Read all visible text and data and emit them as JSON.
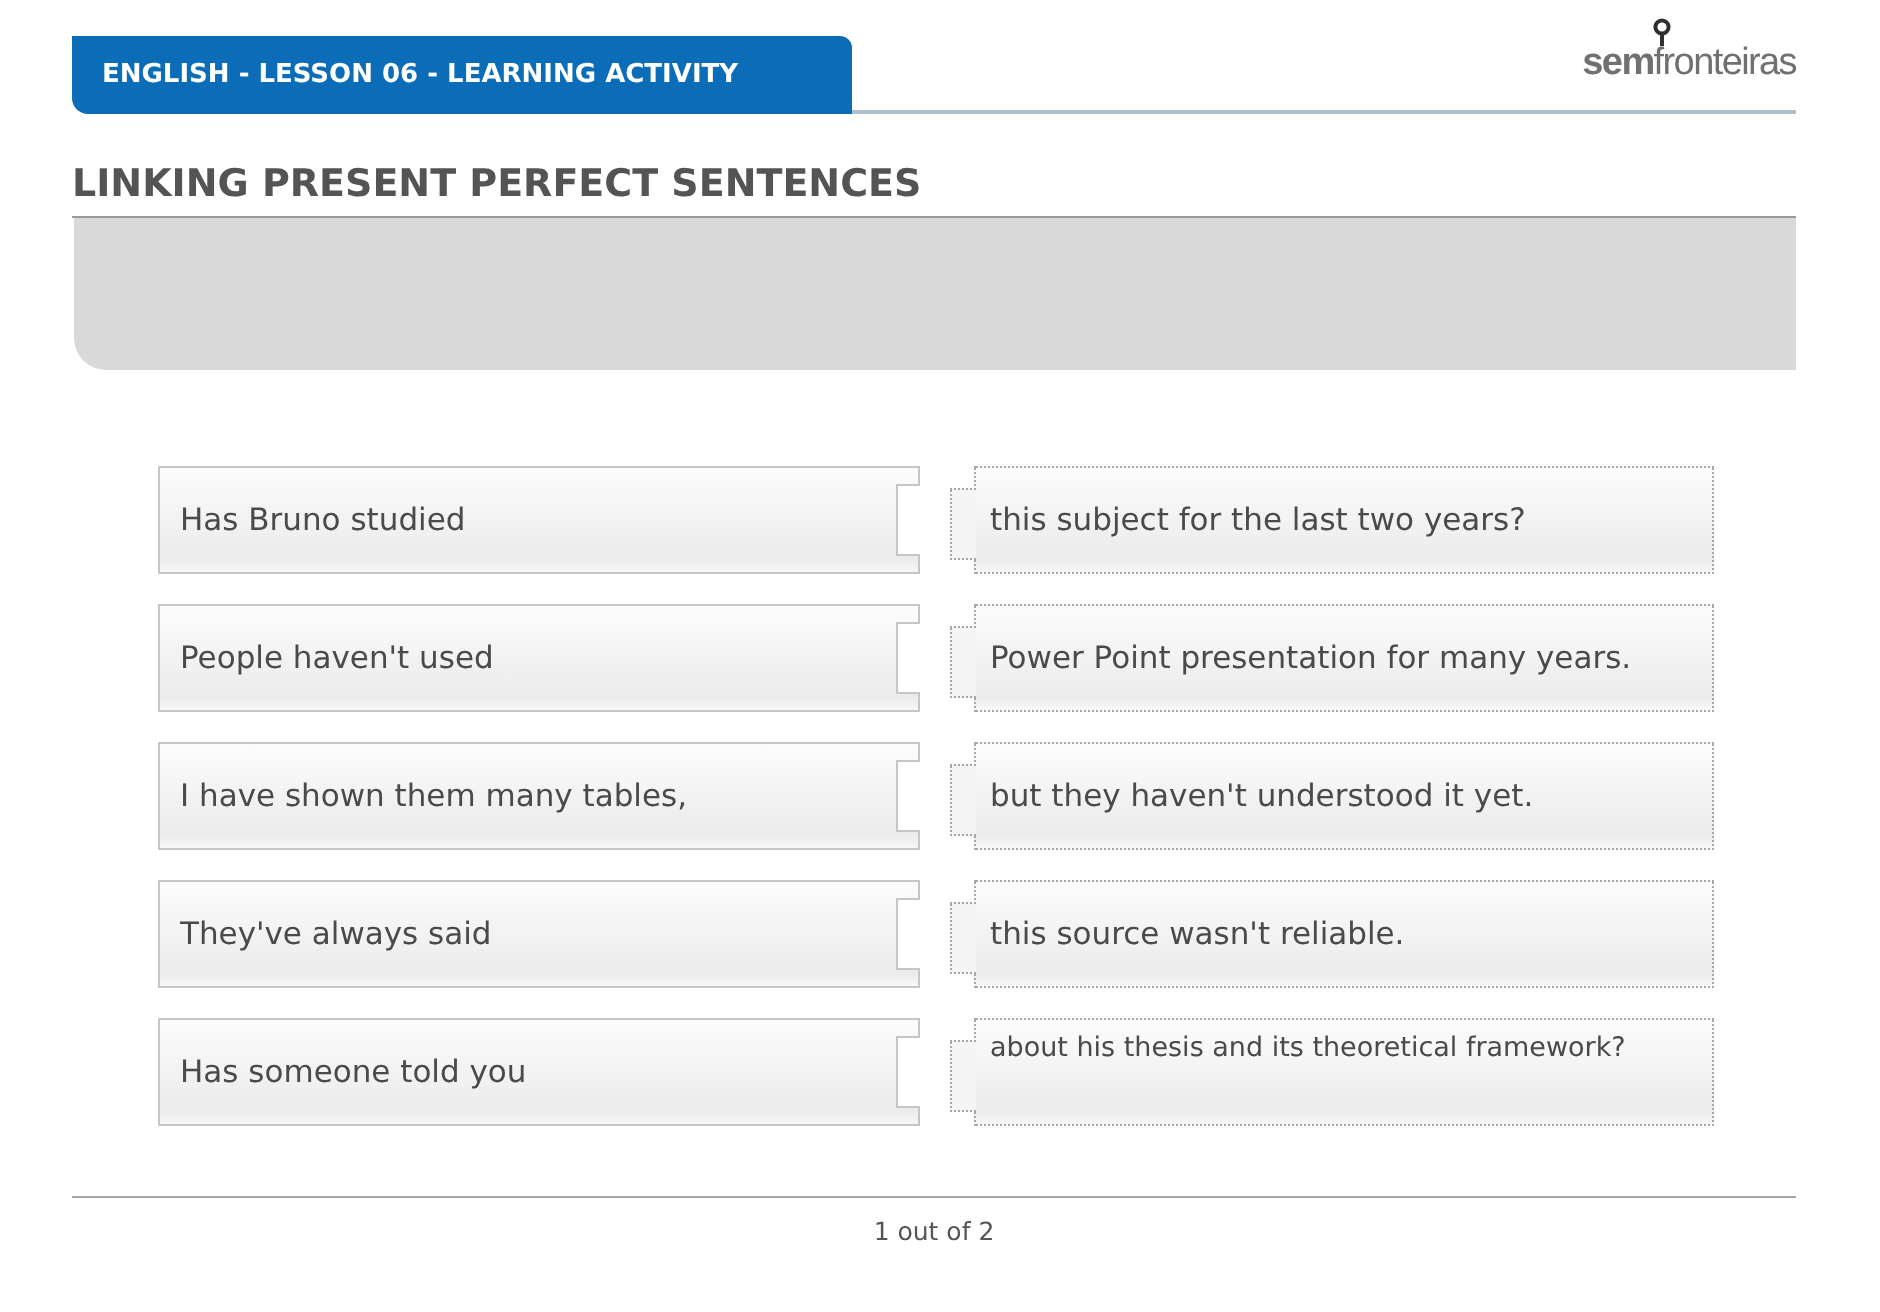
{
  "header": {
    "title": "ENGLISH - LESSON 06 - LEARNING ACTIVITY",
    "logo": "**sem**fronteiras"
  },
  "activity": {
    "title": "LINKING PRESENT PERFECT SENTENCES"
  },
  "sentence_beginnings": [
    "Has Bruno studied",
    "People haven't used",
    "I have shown them many tables,",
    "They've always said",
    "Has someone told you"
  ],
  "sentence_endings": [
    "this subject for the last two years?",
    "Power Point presentation for many years.",
    "but they haven't understood it yet.",
    "this source wasn't reliable.",
    "about his thesis and its theoretical framework?"
  ],
  "pagination": "1 out of 2"
}
